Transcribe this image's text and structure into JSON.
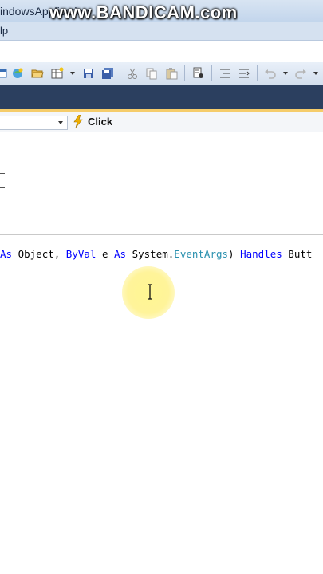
{
  "window": {
    "title": "indowsApplication",
    "watermark": "www.BANDICAM.com"
  },
  "menu": {
    "visible_text": "lp"
  },
  "toolbar": {
    "icons": [
      "new-project-icon",
      "add-item-icon",
      "open-file-icon",
      "add-new-item-icon",
      "save-icon",
      "save-all-icon",
      "cut-icon",
      "copy-icon",
      "paste-icon",
      "find-icon",
      "comment-icon",
      "uncomment-icon",
      "undo-icon",
      "redo-icon"
    ]
  },
  "navbar": {
    "event_label": "Click"
  },
  "code": {
    "line_parts": [
      {
        "text": "As",
        "kind": "keyword"
      },
      {
        "text": " Object, ",
        "kind": "plain"
      },
      {
        "text": "ByVal",
        "kind": "keyword"
      },
      {
        "text": " e ",
        "kind": "plain"
      },
      {
        "text": "As",
        "kind": "keyword"
      },
      {
        "text": " System.",
        "kind": "plain"
      },
      {
        "text": "EventArgs",
        "kind": "type"
      },
      {
        "text": ") ",
        "kind": "plain"
      },
      {
        "text": "Handles",
        "kind": "keyword"
      },
      {
        "text": " Butt",
        "kind": "plain"
      }
    ]
  },
  "colors": {
    "keyword": "#0000ff",
    "type": "#2b91af",
    "tab_strip": "#2b3f5f",
    "tab_accent": "#f5cc6a",
    "cursor_highlight": "#fff28c"
  }
}
